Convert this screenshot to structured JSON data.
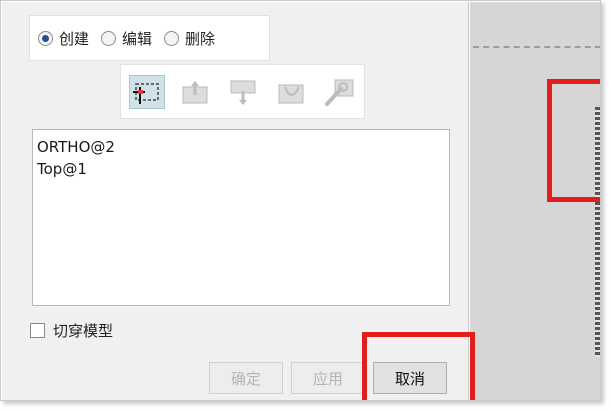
{
  "mode_radios": [
    {
      "label": "创建",
      "selected": true
    },
    {
      "label": "编辑",
      "selected": false
    },
    {
      "label": "删除",
      "selected": false
    }
  ],
  "tools": [
    {
      "icon": "sketch-plane-icon",
      "active": true
    },
    {
      "icon": "cut-up-icon",
      "active": false
    },
    {
      "icon": "cut-down-icon",
      "active": false
    },
    {
      "icon": "cut-curve-icon",
      "active": false
    },
    {
      "icon": "cut-wrench-icon",
      "active": false
    }
  ],
  "view_list": {
    "items": [
      "ORTHO@2",
      "Top@1"
    ]
  },
  "checkbox": {
    "label": "切穿模型",
    "checked": false
  },
  "buttons": {
    "ok": "确定",
    "apply": "应用",
    "cancel": "取消"
  },
  "colors": {
    "highlight_red": "#e11d1d",
    "selected_tool_bg": "#cfe2e8",
    "radio_dot": "#1d4f91"
  }
}
